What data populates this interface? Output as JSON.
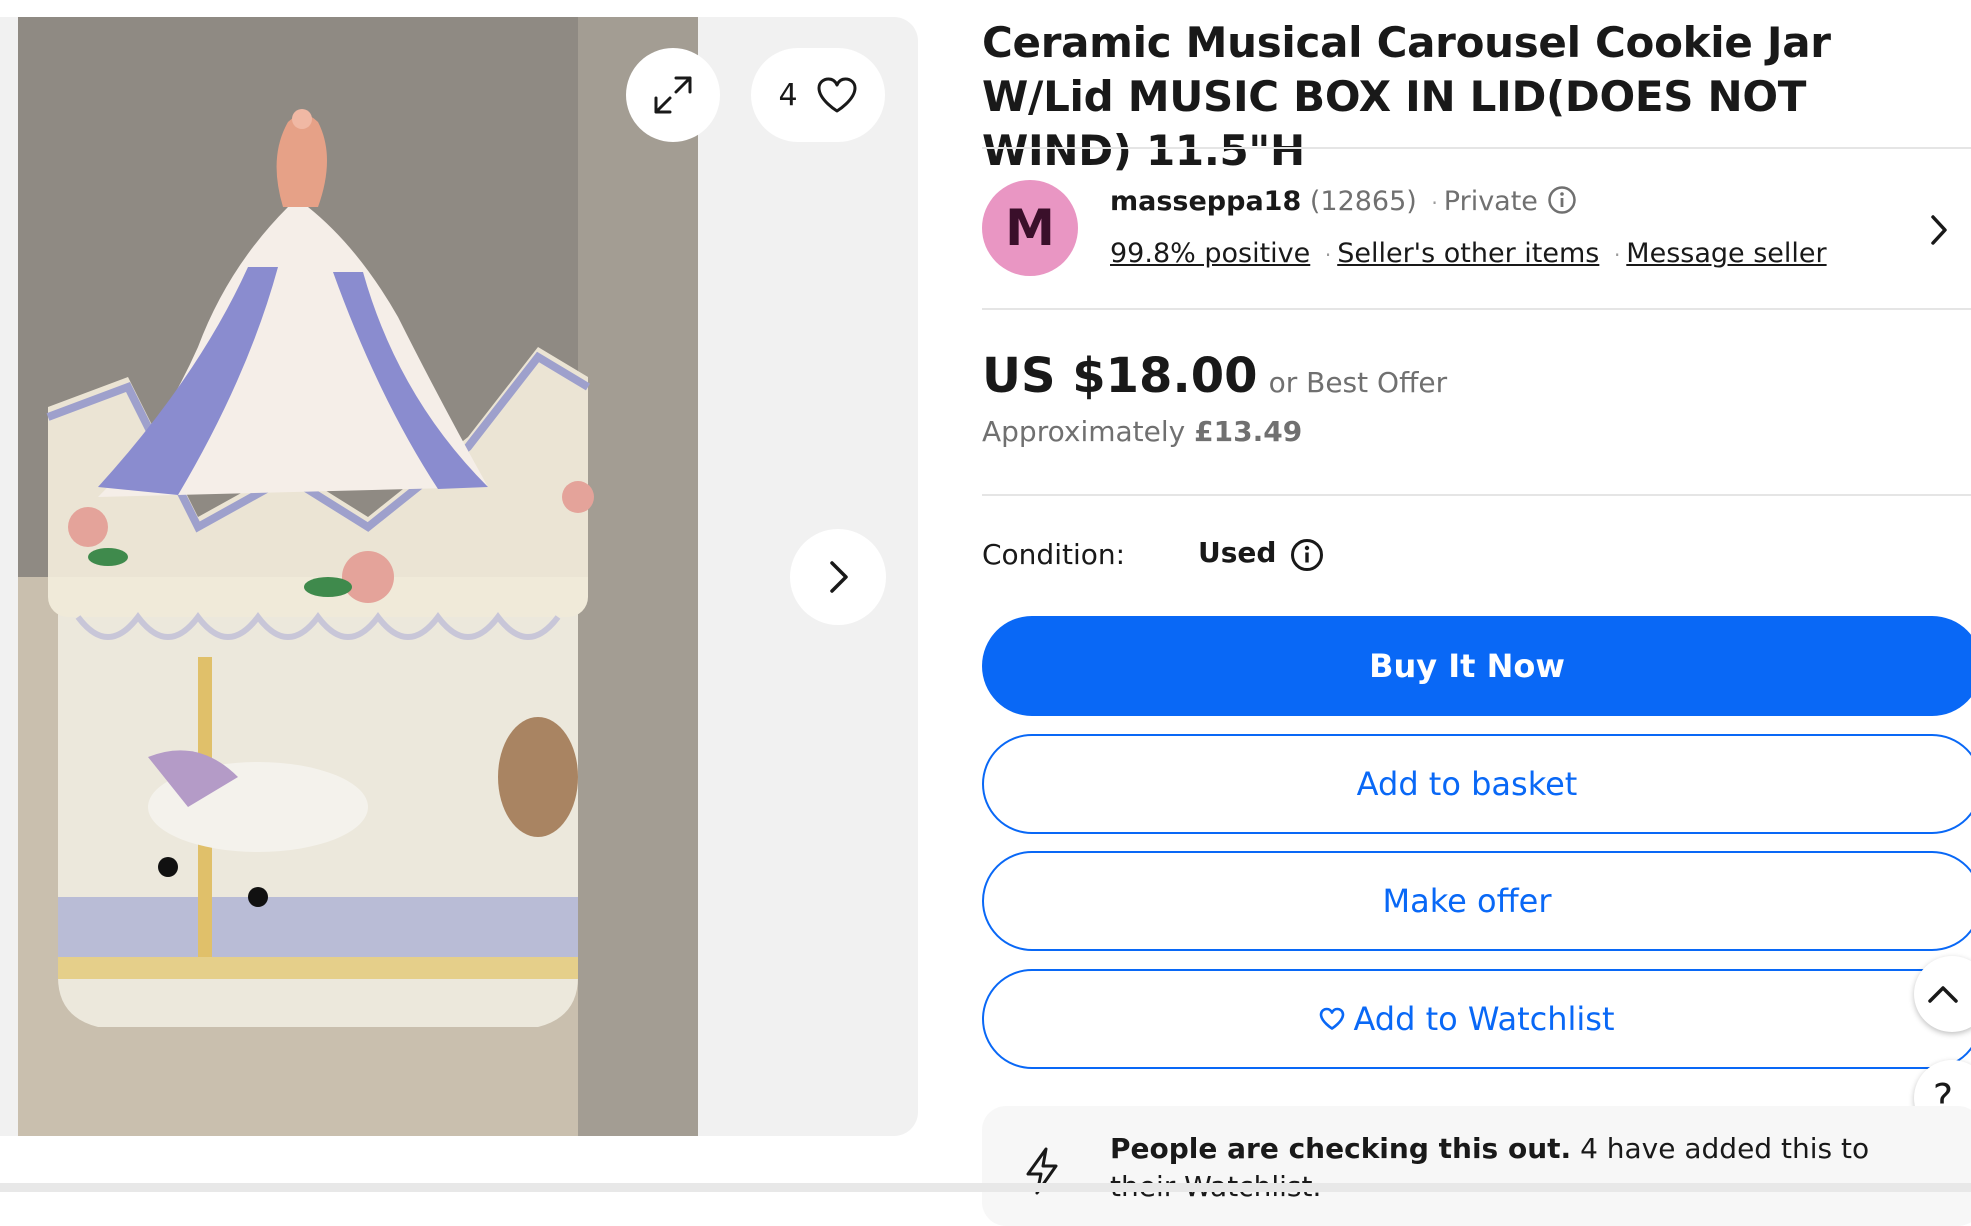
{
  "gallery": {
    "image_alt": "Ceramic carousel cookie jar with blue and white striped lid and carousel horses",
    "watch_count": "4"
  },
  "listing": {
    "title": "Ceramic Musical Carousel Cookie Jar W/Lid MUSIC BOX IN LID(DOES NOT WIND) 11.5\"H"
  },
  "seller": {
    "avatar_initial": "M",
    "name": "masseppa18",
    "feedback_count": "(12865)",
    "type": "Private",
    "positive": "99.8% positive",
    "other_items": "Seller's other items",
    "message": "Message seller"
  },
  "price": {
    "amount": "US $18.00",
    "best_offer": "or Best Offer",
    "approx_label": "Approximately",
    "approx_amount": "£13.49"
  },
  "condition": {
    "label": "Condition:",
    "value": "Used"
  },
  "actions": {
    "buy_now": "Buy It Now",
    "add_to_basket": "Add to basket",
    "make_offer": "Make offer",
    "add_to_watchlist": "Add to Watchlist"
  },
  "help": {
    "label": "?"
  },
  "activity": {
    "headline": "People are checking this out.",
    "detail": "4 have added this to their Watchlist."
  },
  "colors": {
    "primary_blue": "#0968f6",
    "avatar_pink": "#e996c3",
    "text": "#191919",
    "muted": "#707070"
  }
}
